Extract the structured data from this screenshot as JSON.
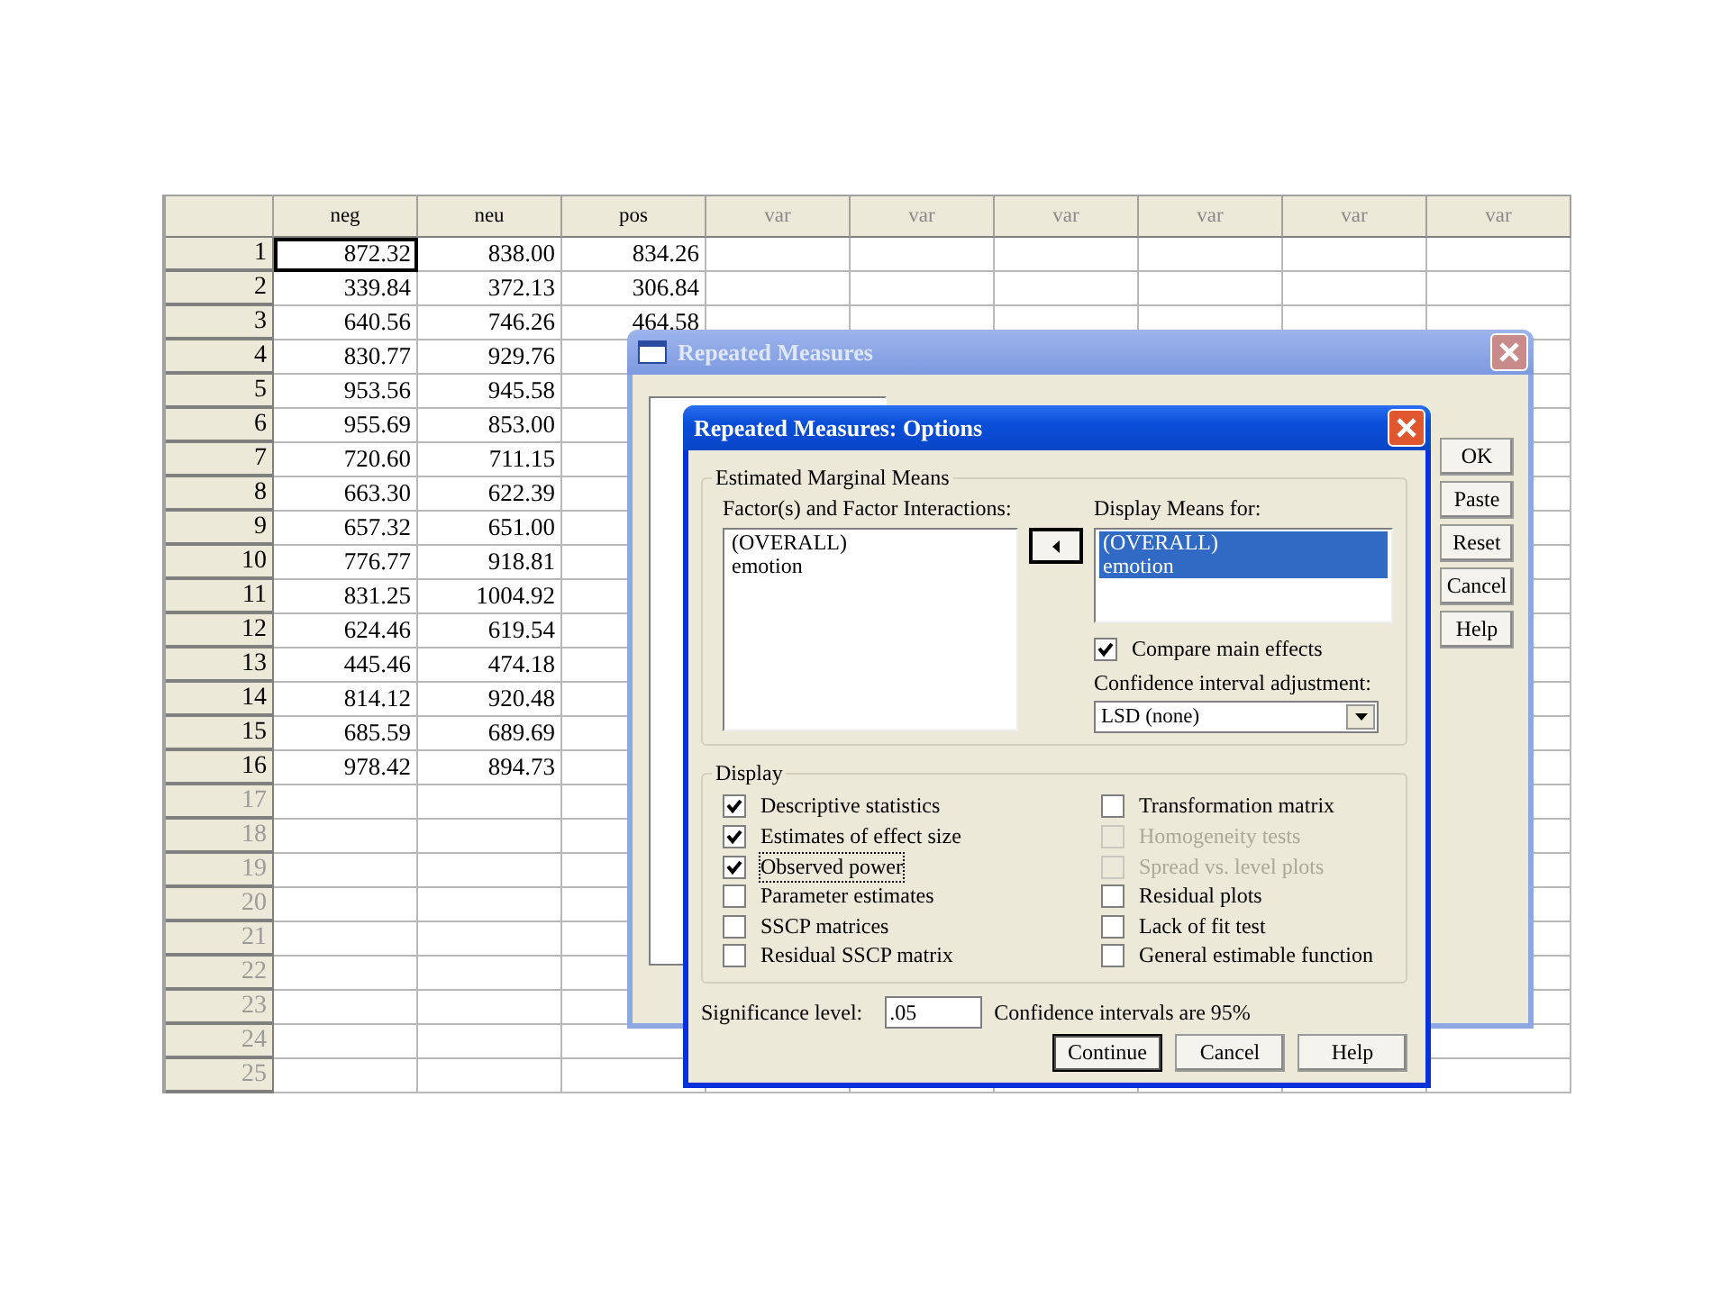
{
  "data_editor": {
    "columns": [
      "neg",
      "neu",
      "pos",
      "var",
      "var",
      "var",
      "var",
      "var",
      "var"
    ],
    "rows": [
      {
        "number": "1",
        "cells": [
          {
            "value": "872.32",
            "selected": true
          },
          {
            "value": "838.00",
            "selected": false
          },
          {
            "value": "834.26",
            "selected": false
          }
        ]
      },
      {
        "number": "2",
        "cells": [
          {
            "value": "339.84",
            "selected": false
          },
          {
            "value": "372.13",
            "selected": false
          },
          {
            "value": "306.84",
            "selected": false
          }
        ]
      },
      {
        "number": "3",
        "cells": [
          {
            "value": "640.56",
            "selected": false
          },
          {
            "value": "746.26",
            "selected": false
          },
          {
            "value": "464.58",
            "selected": false
          }
        ]
      },
      {
        "number": "4",
        "cells": [
          {
            "value": "830.77",
            "selected": false
          },
          {
            "value": "929.76",
            "selected": false
          }
        ]
      },
      {
        "number": "5",
        "cells": [
          {
            "value": "953.56",
            "selected": false
          },
          {
            "value": "945.58",
            "selected": false
          }
        ]
      },
      {
        "number": "6",
        "cells": [
          {
            "value": "955.69",
            "selected": false
          },
          {
            "value": "853.00",
            "selected": false
          }
        ]
      },
      {
        "number": "7",
        "cells": [
          {
            "value": "720.60",
            "selected": false
          },
          {
            "value": "711.15",
            "selected": false
          }
        ]
      },
      {
        "number": "8",
        "cells": [
          {
            "value": "663.30",
            "selected": false
          },
          {
            "value": "622.39",
            "selected": false
          }
        ]
      },
      {
        "number": "9",
        "cells": [
          {
            "value": "657.32",
            "selected": false
          },
          {
            "value": "651.00",
            "selected": false
          }
        ]
      },
      {
        "number": "10",
        "cells": [
          {
            "value": "776.77",
            "selected": false
          },
          {
            "value": "918.81",
            "selected": false
          }
        ]
      },
      {
        "number": "11",
        "cells": [
          {
            "value": "831.25",
            "selected": false
          },
          {
            "value": "1004.92",
            "selected": false
          }
        ]
      },
      {
        "number": "12",
        "cells": [
          {
            "value": "624.46",
            "selected": false
          },
          {
            "value": "619.54",
            "selected": false
          }
        ]
      },
      {
        "number": "13",
        "cells": [
          {
            "value": "445.46",
            "selected": false
          },
          {
            "value": "474.18",
            "selected": false
          }
        ]
      },
      {
        "number": "14",
        "cells": [
          {
            "value": "814.12",
            "selected": false
          },
          {
            "value": "920.48",
            "selected": false
          }
        ]
      },
      {
        "number": "15",
        "cells": [
          {
            "value": "685.59",
            "selected": false
          },
          {
            "value": "689.69",
            "selected": false
          }
        ]
      },
      {
        "number": "16",
        "cells": [
          {
            "value": "978.42",
            "selected": false
          },
          {
            "value": "894.73",
            "selected": false
          }
        ]
      },
      {
        "number": "17"
      },
      {
        "number": "18"
      },
      {
        "number": "19"
      },
      {
        "number": "20"
      },
      {
        "number": "21"
      },
      {
        "number": "22"
      },
      {
        "number": "23"
      },
      {
        "number": "24"
      },
      {
        "number": "25"
      }
    ]
  },
  "main_dialog": {
    "title": "Repeated Measures",
    "buttons": [
      "OK",
      "Paste",
      "Reset",
      "Cancel",
      "Help"
    ]
  },
  "options_dialog": {
    "title": "Repeated Measures: Options",
    "marginal_means": {
      "legend": "Estimated Marginal Means",
      "factors_label": "Factor(s) and Factor Interactions:",
      "factors": [
        "(OVERALL)",
        "emotion"
      ],
      "display_label": "Display Means for:",
      "display_items": [
        {
          "text": "(OVERALL)",
          "selected": true
        },
        {
          "text": "emotion",
          "selected": true
        }
      ],
      "compare": {
        "label": "Compare main effects",
        "checked": true
      },
      "ci_label": "Confidence interval adjustment:",
      "ci_value": "LSD (none)"
    },
    "display": {
      "legend": "Display",
      "options": [
        {
          "label": "Descriptive statistics",
          "checked": true,
          "disabled": false,
          "focused": false
        },
        {
          "label": "Transformation matrix",
          "checked": false,
          "disabled": false,
          "focused": false
        },
        {
          "label": "Estimates of effect size",
          "checked": true,
          "disabled": false,
          "focused": false
        },
        {
          "label": "Homogeneity tests",
          "checked": false,
          "disabled": true,
          "focused": false
        },
        {
          "label": "Observed power",
          "checked": true,
          "disabled": false,
          "focused": true
        },
        {
          "label": "Spread vs. level plots",
          "checked": false,
          "disabled": true,
          "focused": false
        },
        {
          "label": "Parameter estimates",
          "checked": false,
          "disabled": false,
          "focused": false
        },
        {
          "label": "Residual plots",
          "checked": false,
          "disabled": false,
          "focused": false
        },
        {
          "label": "SSCP matrices",
          "checked": false,
          "disabled": false,
          "focused": false
        },
        {
          "label": "Lack of fit test",
          "checked": false,
          "disabled": false,
          "focused": false
        },
        {
          "label": "Residual SSCP matrix",
          "checked": false,
          "disabled": false,
          "focused": false
        },
        {
          "label": "General estimable function",
          "checked": false,
          "disabled": false,
          "focused": false
        }
      ]
    },
    "significance_label": "Significance level:",
    "significance_value": ".05",
    "confidence_note": "Confidence intervals are 95%",
    "buttons": [
      {
        "label": "Continue",
        "default": true
      },
      {
        "label": "Cancel",
        "default": false
      },
      {
        "label": "Help",
        "default": false
      }
    ]
  }
}
